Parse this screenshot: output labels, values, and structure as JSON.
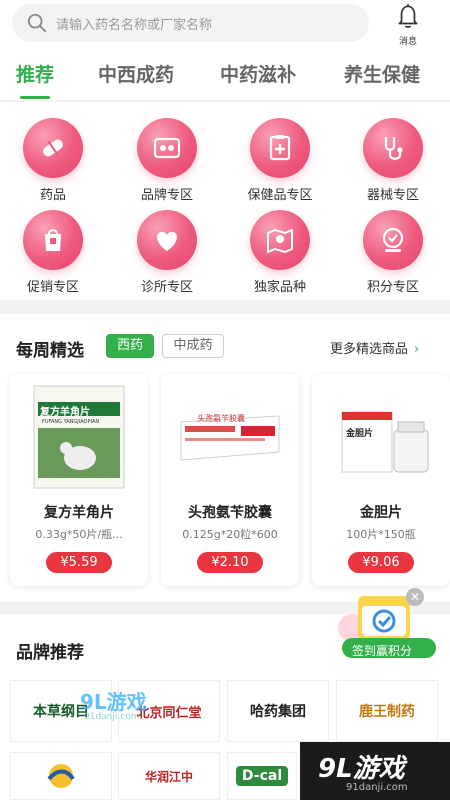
{
  "search": {
    "placeholder": "请输入药名名称或厂家名称"
  },
  "header": {
    "message_label": "消息"
  },
  "tabs": [
    "推荐",
    "中西成药",
    "中药滋补",
    "养生保健"
  ],
  "categories": [
    {
      "label": "药品",
      "icon": "pill-icon"
    },
    {
      "label": "品牌专区",
      "icon": "brand-icon"
    },
    {
      "label": "保健品专区",
      "icon": "health-clipboard-icon"
    },
    {
      "label": "器械专区",
      "icon": "stethoscope-icon"
    },
    {
      "label": "促销专区",
      "icon": "promo-bag-icon"
    },
    {
      "label": "诊所专区",
      "icon": "heart-icon"
    },
    {
      "label": "独家品种",
      "icon": "map-pin-icon"
    },
    {
      "label": "积分专区",
      "icon": "reward-badge-icon"
    }
  ],
  "weekly": {
    "title": "每周精选",
    "filters": [
      "西药",
      "中成药"
    ],
    "more": "更多精选商品",
    "products": [
      {
        "name": "复方羊角片",
        "spec": "0.33g*50片/瓶...",
        "price": "¥5.59",
        "box_text": "复方羊角片",
        "box_sub": "FUFANG YANGJIAOPIAN"
      },
      {
        "name": "头孢氨苄胶囊",
        "spec": "0.125g*20粒*600",
        "price": "¥2.10",
        "box_text": "头孢氨苄胶囊"
      },
      {
        "name": "金胆片",
        "spec": "100片*150瓶",
        "price": "¥9.06",
        "box_text": "金胆片"
      }
    ]
  },
  "brands": {
    "title": "品牌推荐",
    "logos": [
      "本草纲目",
      "北京同仁堂",
      "哈药集团",
      "鹿王制药",
      "",
      "华润江中",
      "D-cal",
      ""
    ]
  },
  "checkin": {
    "label": "签到赢积分"
  },
  "watermark": {
    "big": "9L游戏",
    "small": "91danji.com",
    "mid": "9L游戏",
    "mid_small": "91danji.com"
  },
  "colors": {
    "accent": "#34b04b",
    "icon_pink": "#ee5a7d",
    "price_red": "#e8353f"
  }
}
